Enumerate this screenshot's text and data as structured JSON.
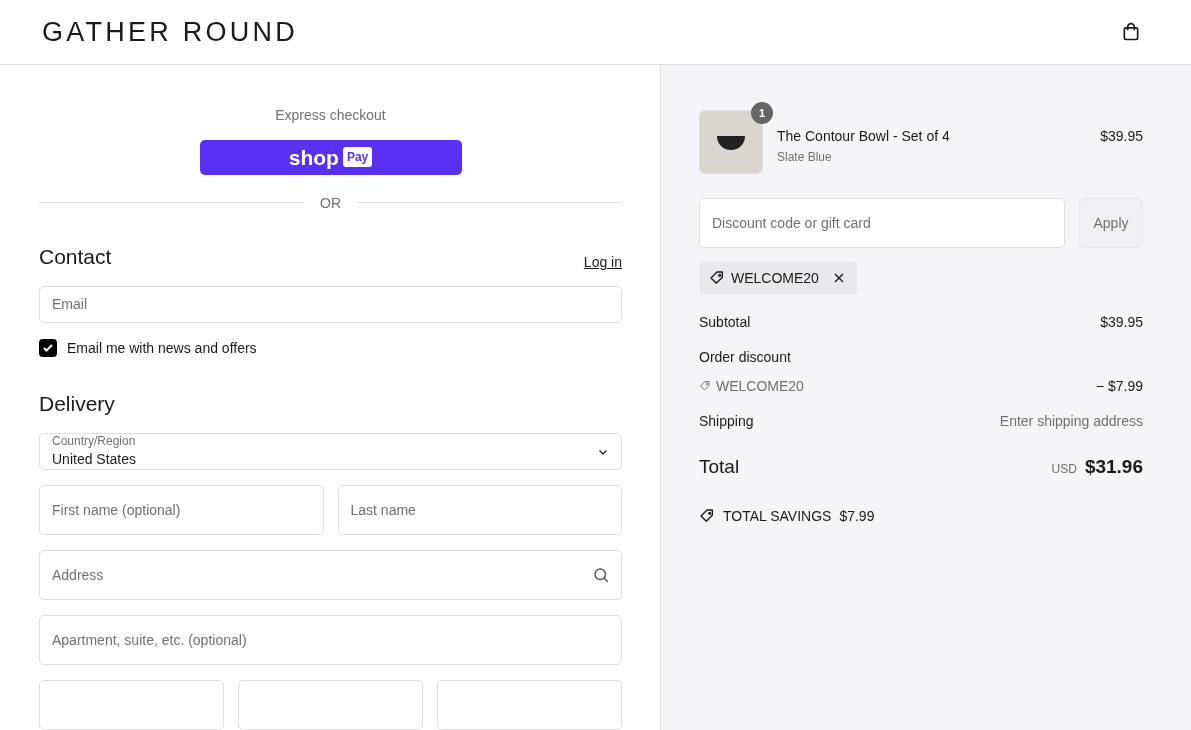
{
  "header": {
    "logo": "GATHER ROUND"
  },
  "express": {
    "title": "Express checkout",
    "shop": "shop",
    "pay": "Pay",
    "divider": "OR"
  },
  "contact": {
    "title": "Contact",
    "login": "Log in",
    "email_placeholder": "Email",
    "newsletter": {
      "label": "Email me with news and offers",
      "checked": true
    }
  },
  "delivery": {
    "title": "Delivery",
    "country_label": "Country/Region",
    "country_value": "United States",
    "fields": [
      {
        "placeholder": "First name (optional)"
      },
      {
        "placeholder": "Last name"
      }
    ],
    "address_placeholder": "Address",
    "apartment_placeholder": "Apartment, suite, etc. (optional)"
  },
  "summary": {
    "item": {
      "quantity": "1",
      "name": "The Contour Bowl - Set of 4",
      "variant": "Slate Blue",
      "price": "$39.95"
    },
    "discount_placeholder": "Discount code or gift card",
    "apply": "Apply",
    "applied_code": "WELCOME20",
    "subtotal_label": "Subtotal",
    "subtotal": "$39.95",
    "order_discount_label": "Order discount",
    "discount_code": "WELCOME20",
    "discount_amount": "− $7.99",
    "shipping_label": "Shipping",
    "shipping_value": "Enter shipping address",
    "total_label": "Total",
    "currency": "USD",
    "total": "$31.96",
    "savings_label": "TOTAL SAVINGS",
    "savings": "$7.99"
  }
}
